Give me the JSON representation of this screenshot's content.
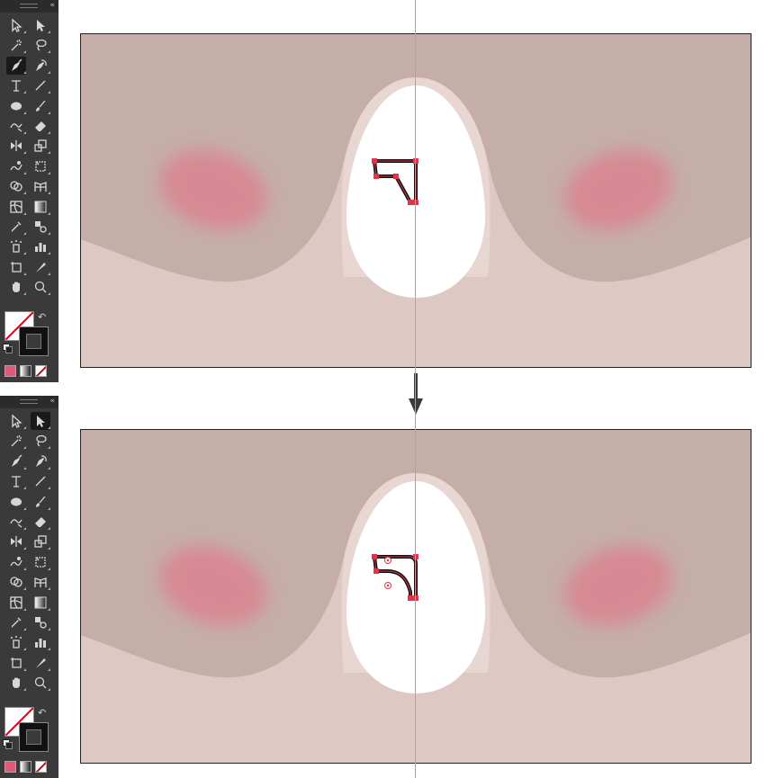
{
  "colors": {
    "toolbar_bg": "#3a3a3a",
    "background_skin": "#c5aea7",
    "lower_skin": "#ddc8c3",
    "egg_halo": "#e8d6d2",
    "egg": "#ffffff",
    "blush": "#d78a93",
    "guide": "#35d5dc",
    "anchor": "#e0344a"
  },
  "panels": [
    {
      "name": "before",
      "active_tool": "pen-tool-icon",
      "path_state": "straight-corner-anchors",
      "icons": [
        "selection-tool-icon",
        "direct-selection-tool-icon",
        "magic-wand-icon",
        "lasso-icon",
        "pen-tool-icon",
        "curvature-tool-icon",
        "type-tool-icon",
        "line-segment-tool-icon",
        "ellipse-tool-icon",
        "paintbrush-icon",
        "shaper-tool-icon",
        "eraser-icon",
        "reflect-tool-icon",
        "scale-tool-icon",
        "warp-tool-icon",
        "free-transform-icon",
        "shape-builder-icon",
        "perspective-grid-icon",
        "mesh-tool-icon",
        "gradient-tool-icon",
        "eyedropper-icon",
        "blend-tool-icon",
        "symbol-sprayer-icon",
        "column-graph-icon",
        "artboard-tool-icon",
        "slice-tool-icon",
        "hand-tool-icon",
        "zoom-tool-icon"
      ]
    },
    {
      "name": "after",
      "active_tool": "direct-selection-tool-icon",
      "path_state": "curved-corner-with-live-corner-widgets",
      "icons": [
        "selection-tool-icon",
        "direct-selection-tool-icon",
        "magic-wand-icon",
        "lasso-icon",
        "pen-tool-icon",
        "curvature-tool-icon",
        "type-tool-icon",
        "line-segment-tool-icon",
        "ellipse-tool-icon",
        "paintbrush-icon",
        "shaper-tool-icon",
        "eraser-icon",
        "reflect-tool-icon",
        "scale-tool-icon",
        "warp-tool-icon",
        "free-transform-icon",
        "shape-builder-icon",
        "perspective-grid-icon",
        "mesh-tool-icon",
        "gradient-tool-icon",
        "eyedropper-icon",
        "blend-tool-icon",
        "symbol-sprayer-icon",
        "column-graph-icon",
        "artboard-tool-icon",
        "slice-tool-icon",
        "hand-tool-icon",
        "zoom-tool-icon"
      ]
    }
  ],
  "arrow_icon": "arrow-down-icon"
}
